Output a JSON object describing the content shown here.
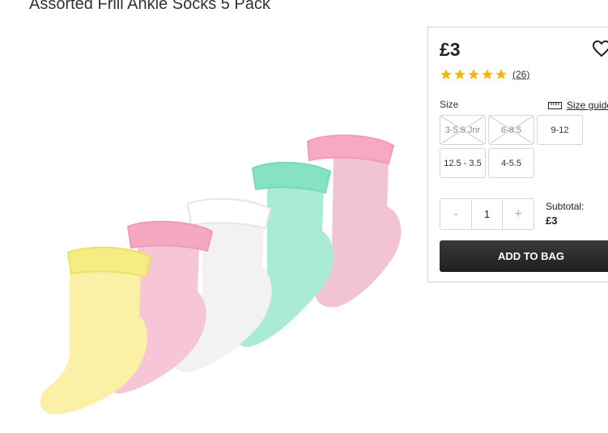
{
  "product": {
    "title": "Assorted Frill Ankle Socks 5 Pack"
  },
  "price": "£3",
  "rating": {
    "stars": 5,
    "review_count": "(26)"
  },
  "size": {
    "label": "Size",
    "guide_label": "Size guide",
    "options": [
      {
        "label": "3-5.5 Jnr",
        "available": false
      },
      {
        "label": "6-8.5",
        "available": false
      },
      {
        "label": "9-12",
        "available": true
      },
      {
        "label": "12.5 - 3.5",
        "available": true
      },
      {
        "label": "4-5.5",
        "available": true
      }
    ]
  },
  "quantity": {
    "minus": "-",
    "value": "1",
    "plus": "+"
  },
  "subtotal": {
    "label": "Subtotal:",
    "value": "£3"
  },
  "add_to_bag": "ADD TO BAG",
  "colors": {
    "star": "#f5b800",
    "button": "#2a2a2a"
  }
}
